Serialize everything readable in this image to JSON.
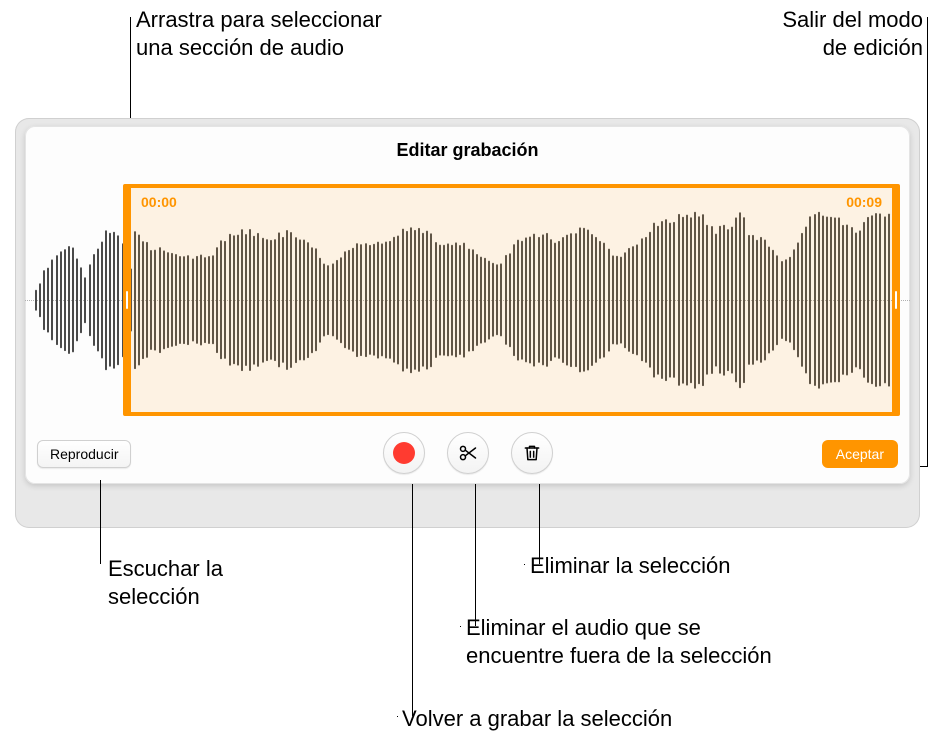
{
  "callouts": {
    "drag_select": "Arrastra para seleccionar\nuna sección de audio",
    "exit_edit": "Salir del modo\nde edición",
    "listen_selection": "Escuchar la\nselección",
    "delete_selection": "Eliminar la selección",
    "trim_outside": "Eliminar el audio que se\nencuentre fuera de la selección",
    "rerecord": "Volver a grabar la selección"
  },
  "panel": {
    "title": "Editar grabación",
    "time_start": "00:00",
    "time_end": "00:09",
    "play_label": "Reproducir",
    "accept_label": "Aceptar",
    "icon_names": {
      "record": "record-icon",
      "trim": "scissors-icon",
      "delete": "trash-icon"
    }
  }
}
